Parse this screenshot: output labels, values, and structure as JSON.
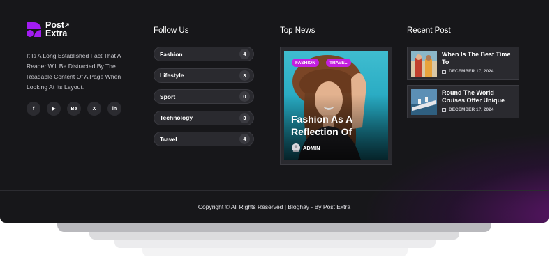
{
  "brand": {
    "logo_line1": "Post",
    "logo_line2": "Extra",
    "logo_arrow": "↗",
    "accent_color": "#a21cf2"
  },
  "about": {
    "text": "It Is A Long Established Fact That A Reader Will Be Distracted By The Readable Content Of A Page When Looking At Its Layout."
  },
  "socials": [
    {
      "icon": "facebook-icon",
      "glyph": "f"
    },
    {
      "icon": "youtube-icon",
      "glyph": "▶"
    },
    {
      "icon": "behance-icon",
      "glyph": "Bē"
    },
    {
      "icon": "x-icon",
      "glyph": "X"
    },
    {
      "icon": "linkedin-icon",
      "glyph": "in"
    }
  ],
  "follow": {
    "title": "Follow Us",
    "categories": [
      {
        "label": "Fashion",
        "count": "4"
      },
      {
        "label": "Lifestyle",
        "count": "3"
      },
      {
        "label": "Sport",
        "count": "0"
      },
      {
        "label": "Technology",
        "count": "3"
      },
      {
        "label": "Travel",
        "count": "4"
      }
    ]
  },
  "top_news": {
    "title": "Top News",
    "tags": [
      "FASHION",
      "TRAVEL"
    ],
    "headline": "Fashion As A Reflection Of",
    "author": "ADMIN",
    "tag_color": "#c41fe0"
  },
  "recent": {
    "title": "Recent Post",
    "posts": [
      {
        "title": "When Is The Best Time To",
        "date": "DECEMBER 17, 2024"
      },
      {
        "title": "Round The World Cruises Offer Unique",
        "date": "DECEMBER 17, 2024"
      }
    ]
  },
  "copyright": "Copyright © All Rights Reserved | Bloghay - By Post Extra"
}
